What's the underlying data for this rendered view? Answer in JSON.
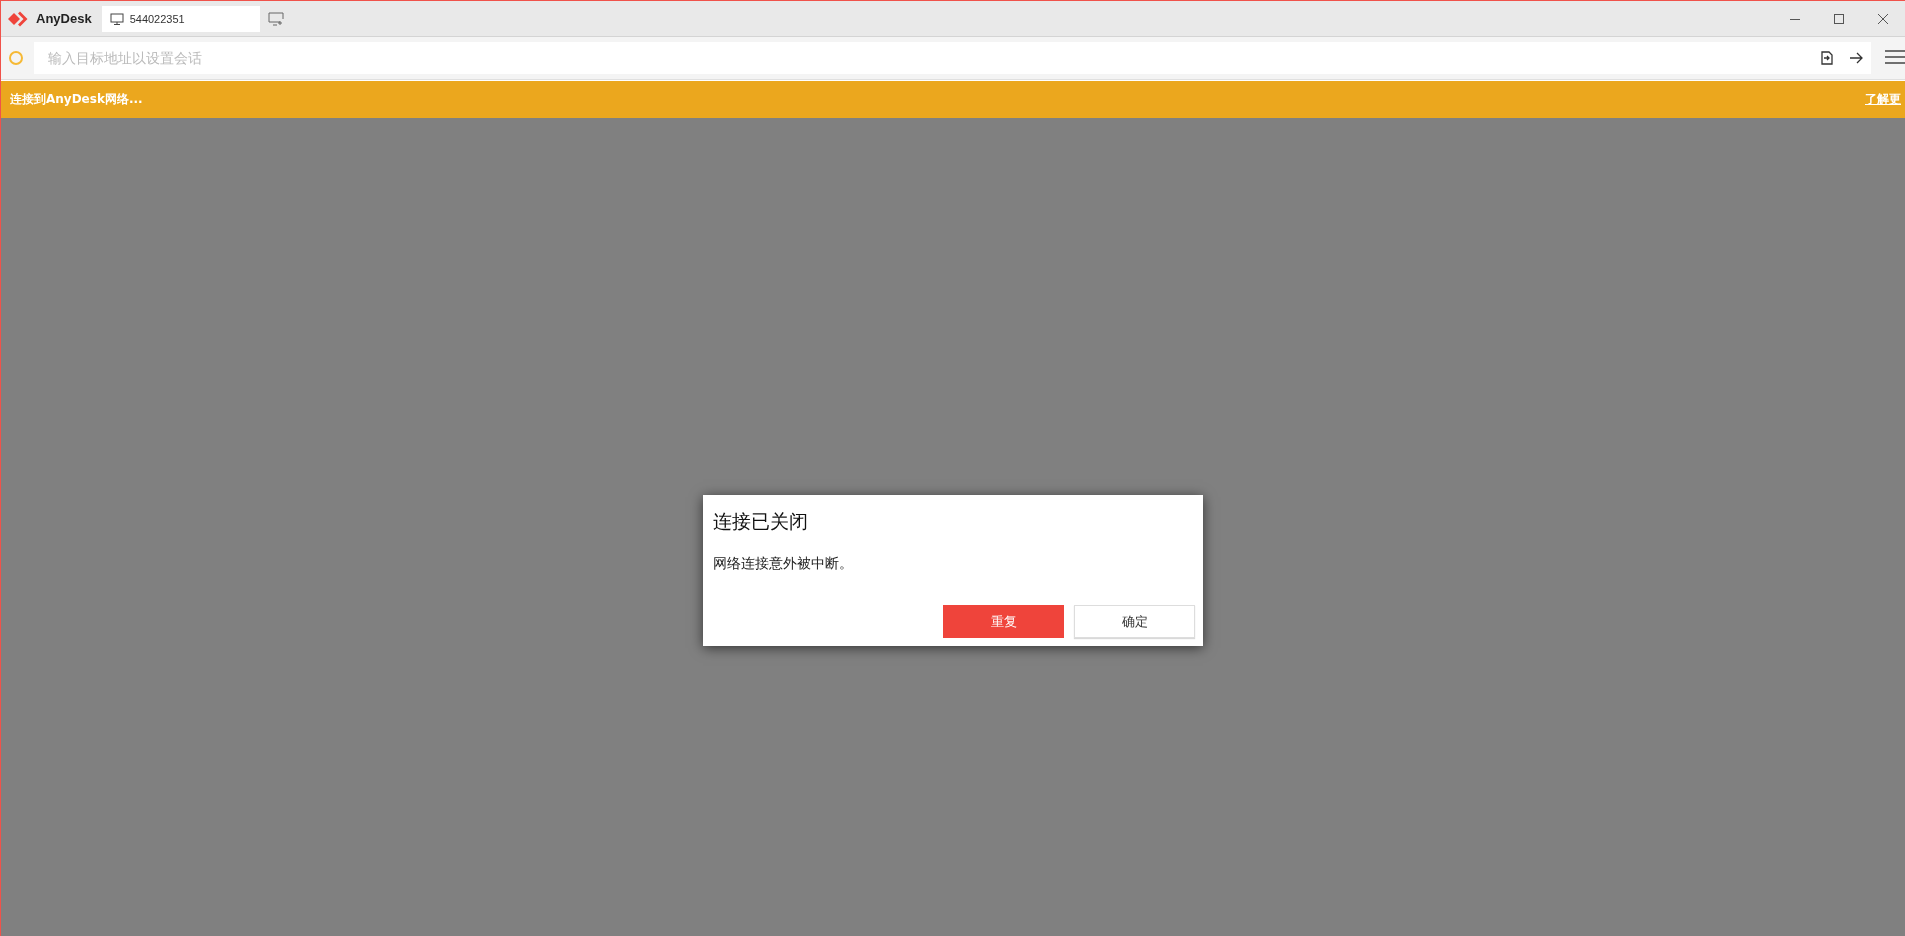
{
  "app": {
    "name": "AnyDesk"
  },
  "session_tab": {
    "label": "544022351",
    "selected": true
  },
  "address_bar": {
    "placeholder": "输入目标地址以设置会话"
  },
  "banner": {
    "message": "连接到AnyDesk网络...",
    "link": "了解更"
  },
  "dialog": {
    "title": "连接已关闭",
    "message": "网络连接意外被中断。",
    "buttons": [
      {
        "label": "重复",
        "kind": "primary"
      },
      {
        "label": "确定",
        "kind": "secondary"
      }
    ]
  }
}
